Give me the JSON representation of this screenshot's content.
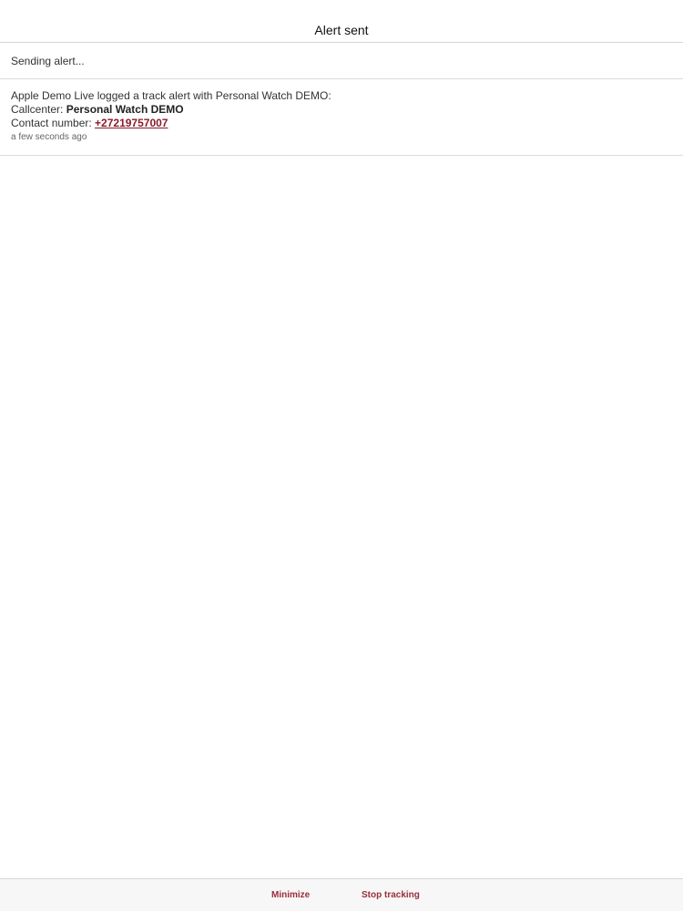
{
  "header": {
    "title": "Alert sent"
  },
  "status": {
    "sending_text": "Sending alert..."
  },
  "alert": {
    "summary": "Apple Demo Live logged a track alert with Personal Watch DEMO:",
    "callcenter_label": "Callcenter: ",
    "callcenter_value": "Personal Watch DEMO",
    "contact_label": "Contact number: ",
    "contact_value": "+27219757007",
    "timestamp": "a few seconds ago"
  },
  "footer": {
    "minimize_label": "Minimize",
    "stop_tracking_label": "Stop tracking"
  },
  "colors": {
    "accent": "#9b2d3a",
    "link": "#8b1a2b"
  }
}
